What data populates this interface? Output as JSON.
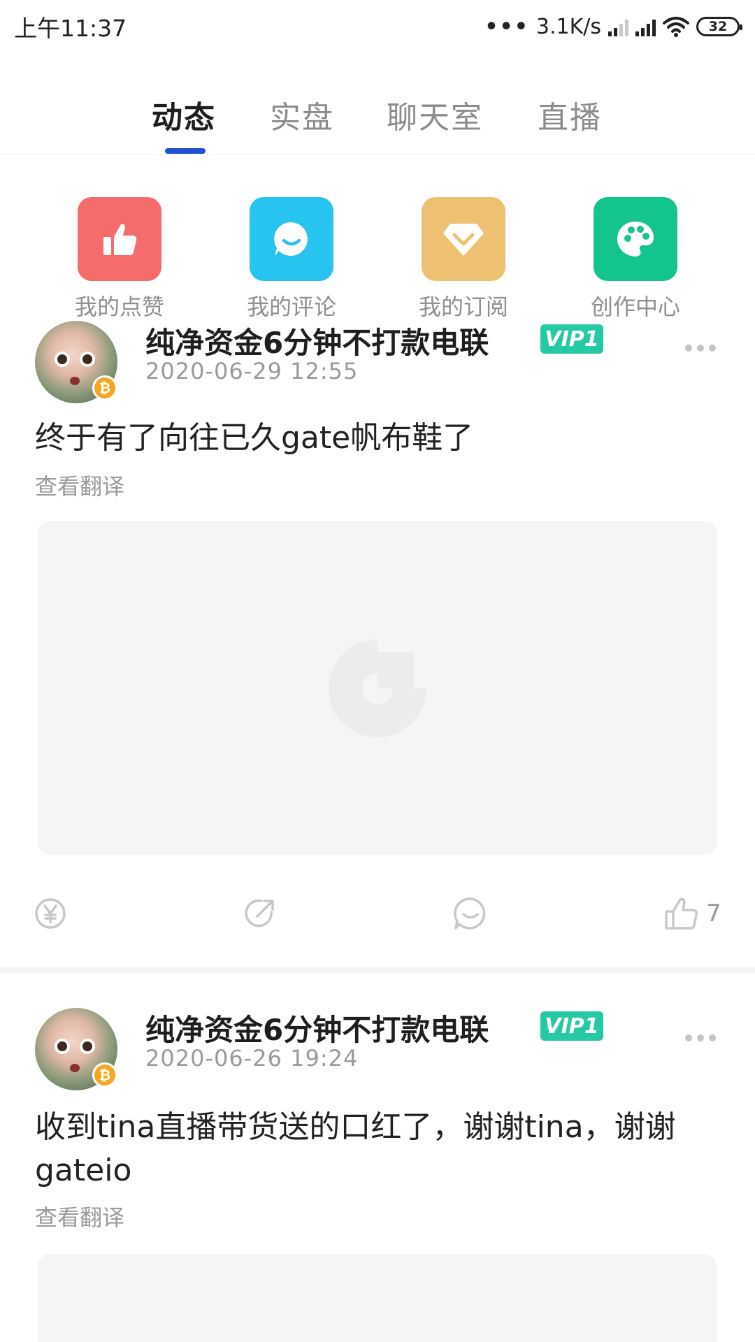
{
  "status_bar": {
    "time": "上午11:37",
    "dots": "•••",
    "network_speed": "3.1K/s",
    "battery": "32"
  },
  "tabs": [
    {
      "label": "动态",
      "active": true
    },
    {
      "label": "实盘",
      "active": false
    },
    {
      "label": "聊天室",
      "active": false
    },
    {
      "label": "直播",
      "active": false
    }
  ],
  "shortcuts": [
    {
      "label": "我的点赞",
      "icon": "thumbs-up-icon",
      "color": "#f56c6c"
    },
    {
      "label": "我的评论",
      "icon": "chat-bubble-icon",
      "color": "#26c4ee"
    },
    {
      "label": "我的订阅",
      "icon": "diamond-icon",
      "color": "#eec071"
    },
    {
      "label": "创作中心",
      "icon": "palette-icon",
      "color": "#14c48e"
    }
  ],
  "posts": [
    {
      "username": "纯净资金6分钟不打款电联",
      "vip": "VIP1",
      "timestamp": "2020-06-29 12:55",
      "content": "终于有了向往已久gate帆布鞋了",
      "translate": "查看翻译",
      "like_count": "7"
    },
    {
      "username": "纯净资金6分钟不打款电联",
      "vip": "VIP1",
      "timestamp": "2020-06-26 19:24",
      "content": "收到tina直播带货送的口红了，谢谢tina，谢谢gateio",
      "translate": "查看翻译"
    }
  ],
  "colors": {
    "tab_indicator": "#2150d6",
    "vip_badge": "#25c9a3",
    "image_placeholder": "#f5f5f5"
  }
}
